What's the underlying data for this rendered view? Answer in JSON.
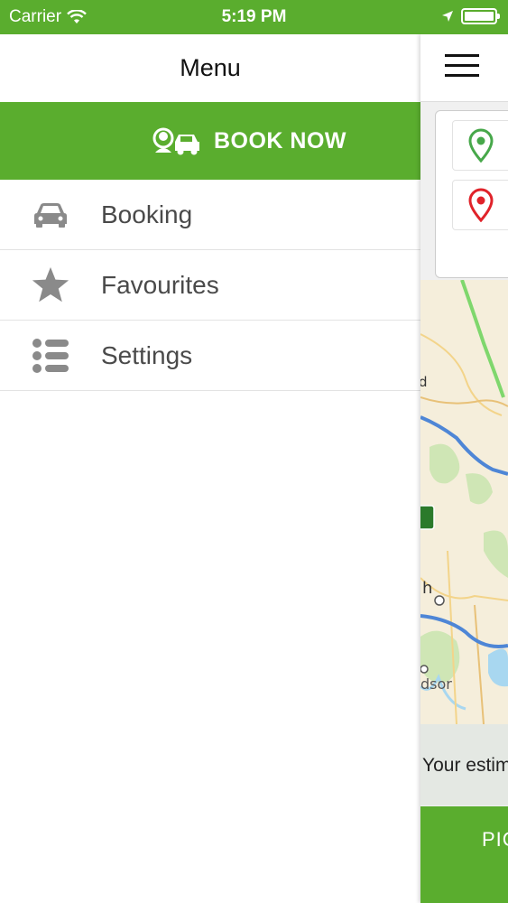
{
  "status_bar": {
    "carrier": "Carrier",
    "time": "5:19 PM",
    "battery_level": 1.0
  },
  "menu": {
    "title": "Menu",
    "book_now_label": "BOOK NOW",
    "book_now_icon": "driver-car-icon",
    "items": [
      {
        "label": "Booking",
        "icon": "car-icon"
      },
      {
        "label": "Favourites",
        "icon": "star-icon"
      },
      {
        "label": "Settings",
        "icon": "list-icon"
      }
    ]
  },
  "main": {
    "pickup_pin_icon": "pickup-pin-icon",
    "dropoff_pin_icon": "dropoff-pin-icon",
    "map_labels": [
      "d",
      "h",
      "dsor"
    ],
    "estimate_text": "Your estim",
    "pickup_button_label": "PIC"
  },
  "colors": {
    "brand_green": "#5aad2e",
    "pickup_pin": "#47a84a",
    "dropoff_pin": "#e0232a",
    "icon_gray": "#8a8a8a",
    "route_blue": "#4e86d6",
    "route_green": "#7fd76d"
  }
}
